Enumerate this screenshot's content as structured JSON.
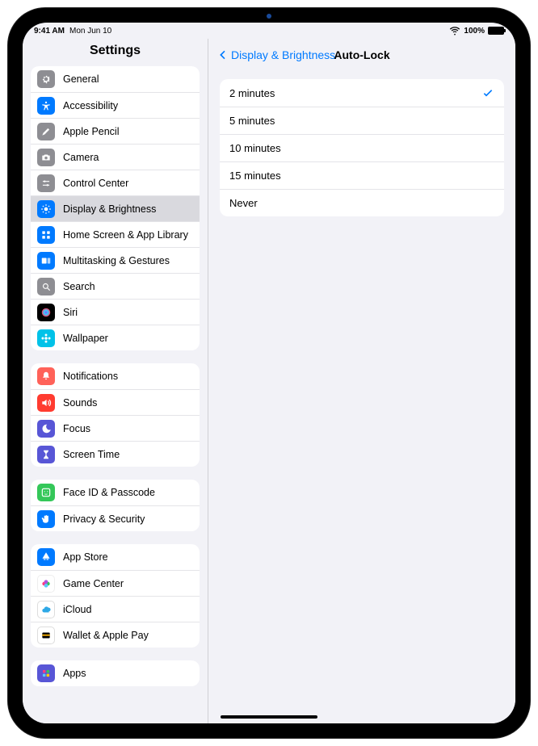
{
  "status": {
    "time": "9:41 AM",
    "date": "Mon Jun 10",
    "battery": "100%"
  },
  "sidebar": {
    "title": "Settings",
    "selected": "display-brightness",
    "groups": [
      [
        {
          "id": "general",
          "label": "General",
          "iconClass": "ic-grey",
          "icon": "gear"
        },
        {
          "id": "accessibility",
          "label": "Accessibility",
          "iconClass": "ic-blue",
          "icon": "accessibility"
        },
        {
          "id": "apple-pencil",
          "label": "Apple Pencil",
          "iconClass": "ic-grey",
          "icon": "pencil"
        },
        {
          "id": "camera",
          "label": "Camera",
          "iconClass": "ic-grey",
          "icon": "camera"
        },
        {
          "id": "control-center",
          "label": "Control Center",
          "iconClass": "ic-grey",
          "icon": "sliders"
        },
        {
          "id": "display-brightness",
          "label": "Display & Brightness",
          "iconClass": "ic-blue",
          "icon": "sun"
        },
        {
          "id": "home-screen",
          "label": "Home Screen & App Library",
          "iconClass": "ic-blue",
          "icon": "grid"
        },
        {
          "id": "multitasking",
          "label": "Multitasking & Gestures",
          "iconClass": "ic-blue",
          "icon": "rects"
        },
        {
          "id": "search",
          "label": "Search",
          "iconClass": "ic-grey",
          "icon": "search"
        },
        {
          "id": "siri",
          "label": "Siri",
          "iconClass": "ic-black",
          "icon": "siri"
        },
        {
          "id": "wallpaper",
          "label": "Wallpaper",
          "iconClass": "ic-cyan",
          "icon": "flower"
        }
      ],
      [
        {
          "id": "notifications",
          "label": "Notifications",
          "iconClass": "ic-orange",
          "icon": "bell"
        },
        {
          "id": "sounds",
          "label": "Sounds",
          "iconClass": "ic-red",
          "icon": "speaker"
        },
        {
          "id": "focus",
          "label": "Focus",
          "iconClass": "ic-indigo",
          "icon": "moon"
        },
        {
          "id": "screen-time",
          "label": "Screen Time",
          "iconClass": "ic-indigo",
          "icon": "hourglass"
        }
      ],
      [
        {
          "id": "face-id",
          "label": "Face ID & Passcode",
          "iconClass": "ic-green",
          "icon": "faceid"
        },
        {
          "id": "privacy",
          "label": "Privacy & Security",
          "iconClass": "ic-blue",
          "icon": "hand"
        }
      ],
      [
        {
          "id": "app-store",
          "label": "App Store",
          "iconClass": "ic-blue",
          "icon": "appstore"
        },
        {
          "id": "game-center",
          "label": "Game Center",
          "iconClass": "ic-gamecenter",
          "icon": "gamecenter"
        },
        {
          "id": "icloud",
          "label": "iCloud",
          "iconClass": "ic-white",
          "icon": "cloud"
        },
        {
          "id": "wallet",
          "label": "Wallet & Apple Pay",
          "iconClass": "ic-white",
          "icon": "wallet"
        }
      ],
      [
        {
          "id": "apps",
          "label": "Apps",
          "iconClass": "ic-indigo",
          "icon": "apps"
        }
      ]
    ]
  },
  "detail": {
    "back_label": "Display & Brightness",
    "title": "Auto-Lock",
    "selected": "2 minutes",
    "options": [
      "2 minutes",
      "5 minutes",
      "10 minutes",
      "15 minutes",
      "Never"
    ]
  }
}
